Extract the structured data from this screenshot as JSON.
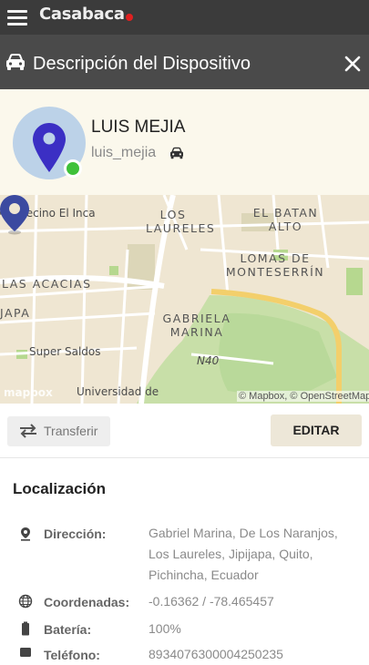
{
  "app": {
    "brand": "Casabaca"
  },
  "header": {
    "title": "Descripción del Dispositivo"
  },
  "user": {
    "name": "LUIS MEJIA",
    "login": "luis_mejia"
  },
  "map": {
    "labels": {
      "vecino": "AKI Vecino El Inca",
      "laureles": "LOS\nLAURELES",
      "batan": "EL BATAN\nALTO",
      "lomas": "LOMAS DE\nMONTESERRÍN",
      "acacias": "LAS ACACIAS",
      "japa": "JAPA",
      "gabriela": "GABRIELA\nMARINA",
      "road": "N40",
      "super": "Super Saldos",
      "universidad": "Universidad de"
    },
    "logo": "mapbox",
    "attribution": "© Mapbox, © OpenStreetMap"
  },
  "actions": {
    "transfer": "Transferir",
    "edit": "EDITAR"
  },
  "location": {
    "title": "Localización",
    "rows": [
      {
        "icon": "location-pin-icon",
        "label": "Dirección:",
        "value": "Gabriel Marina, De Los Naranjos, Los Laureles, Jipijapa, Quito, Pichincha, Ecuador"
      },
      {
        "icon": "globe-icon",
        "label": "Coordenadas:",
        "value": "-0.16362 / -78.465457"
      },
      {
        "icon": "battery-icon",
        "label": "Batería:",
        "value": "100%"
      },
      {
        "icon": "phone-icon",
        "label": "Teléfono:",
        "value": "8934076300004250235"
      }
    ]
  },
  "colors": {
    "topbar": "#3b3b3b",
    "titlebar": "#4a4a4a",
    "panel": "#fbf8ec",
    "online": "#3fc13a",
    "pin": "#3b4aa0",
    "brand_dot": "#e02020"
  }
}
